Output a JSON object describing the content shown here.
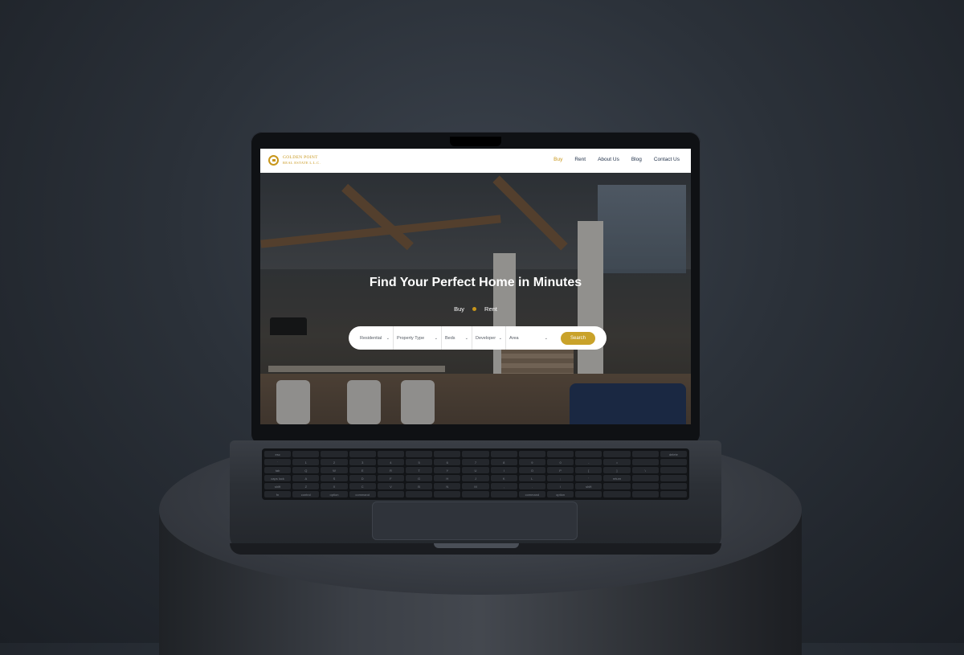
{
  "brand": {
    "name": "GOLDEN POINT",
    "subtitle": "REAL ESTATE L.L.C."
  },
  "nav": {
    "items": [
      "Buy",
      "Rent",
      "About Us",
      "Blog",
      "Contact Us"
    ],
    "active": "Buy"
  },
  "hero": {
    "title": "Find Your Perfect Home in Minutes",
    "tabs": [
      "Buy",
      "Rent"
    ]
  },
  "search": {
    "fields": [
      {
        "label": "Residential"
      },
      {
        "label": "Property Type"
      },
      {
        "label": "Beds"
      },
      {
        "label": "Developer"
      },
      {
        "label": "Area"
      }
    ],
    "button": "Search"
  },
  "keyboard": {
    "rows": [
      [
        "esc",
        "",
        "",
        "",
        "",
        "",
        "",
        "",
        "",
        "",
        "",
        "",
        "",
        "",
        "delete"
      ],
      [
        "`",
        "1",
        "2",
        "3",
        "4",
        "5",
        "6",
        "7",
        "8",
        "9",
        "0",
        "-",
        "=",
        "",
        ""
      ],
      [
        "tab",
        "Q",
        "W",
        "E",
        "R",
        "T",
        "Y",
        "U",
        "I",
        "O",
        "P",
        "[",
        "]",
        "\\",
        ""
      ],
      [
        "caps lock",
        "A",
        "S",
        "D",
        "F",
        "G",
        "H",
        "J",
        "K",
        "L",
        ";",
        "'",
        "return",
        "",
        ""
      ],
      [
        "shift",
        "Z",
        "X",
        "C",
        "V",
        "B",
        "N",
        "M",
        ",",
        ".",
        "/",
        "shift",
        "",
        "",
        ""
      ],
      [
        "fn",
        "control",
        "option",
        "command",
        "",
        "",
        "",
        "",
        "",
        "command",
        "option",
        "",
        "",
        "",
        ""
      ]
    ]
  },
  "colors": {
    "accent": "#c8961a",
    "nav_text": "#22324a",
    "search_button": "#c9a22a"
  }
}
